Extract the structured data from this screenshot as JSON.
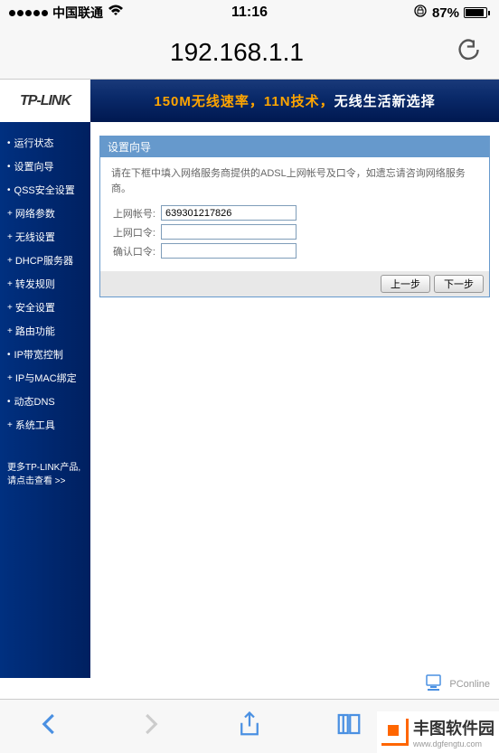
{
  "status_bar": {
    "carrier": "中国联通",
    "time": "11:16",
    "battery_percent": "87%"
  },
  "browser": {
    "url": "192.168.1.1"
  },
  "banner": {
    "logo": "TP-LINK",
    "slogan_speed": "150M无线速率，",
    "slogan_tech": "11N技术，",
    "slogan_life": "无线生活新选择"
  },
  "sidebar": {
    "items": [
      {
        "label": "运行状态"
      },
      {
        "label": "设置向导"
      },
      {
        "label": "QSS安全设置"
      },
      {
        "label": "网络参数"
      },
      {
        "label": "无线设置"
      },
      {
        "label": "DHCP服务器"
      },
      {
        "label": "转发规则"
      },
      {
        "label": "安全设置"
      },
      {
        "label": "路由功能"
      },
      {
        "label": "IP带宽控制"
      },
      {
        "label": "IP与MAC绑定"
      },
      {
        "label": "动态DNS"
      },
      {
        "label": "系统工具"
      }
    ],
    "promo_line1": "更多TP-LINK产品,",
    "promo_line2": "请点击查看 >>"
  },
  "panel": {
    "title": "设置向导",
    "instruction": "请在下框中填入网络服务商提供的ADSL上网帐号及口令，如遗忘请咨询网络服务商。",
    "fields": {
      "account_label": "上网帐号:",
      "account_value": "639301217826",
      "password_label": "上网口令:",
      "password_value": "",
      "confirm_label": "确认口令:",
      "confirm_value": ""
    },
    "buttons": {
      "prev": "上一步",
      "next": "下一步"
    }
  },
  "watermark": {
    "pconline": "PConline",
    "site_url": "www.dgfengtu.com",
    "site_name": "丰图软件园"
  }
}
